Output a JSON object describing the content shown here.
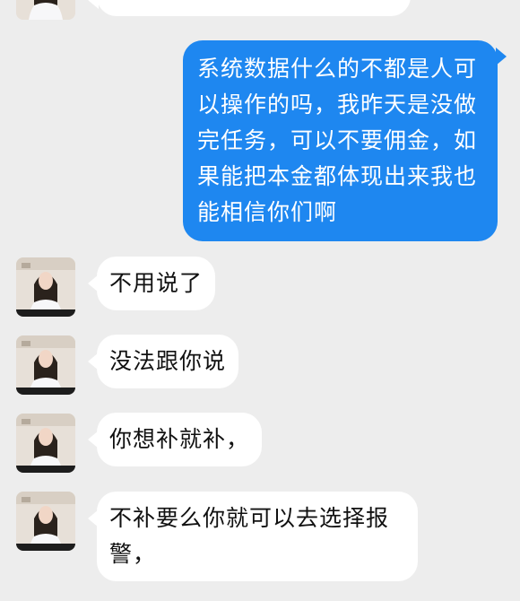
{
  "chat": {
    "messages": [
      {
        "sender": "other",
        "text": ""
      },
      {
        "sender": "self",
        "text": "系统数据什么的不都是人可\n以操作的吗，我昨天是没做\n完任务，可以不要佣金，如\n果能把本金都体现出来我也\n能相信你们啊"
      },
      {
        "sender": "other",
        "text": "不用说了"
      },
      {
        "sender": "other",
        "text": "没法跟你说"
      },
      {
        "sender": "other",
        "text": "你想补就补，"
      },
      {
        "sender": "other",
        "text": "不补要么你就可以去选择报\n警，"
      }
    ]
  },
  "colors": {
    "background": "#ededed",
    "incoming_bubble": "#ffffff",
    "outgoing_bubble": "#1e87f0",
    "incoming_text": "#111111",
    "outgoing_text": "#ffffff"
  }
}
